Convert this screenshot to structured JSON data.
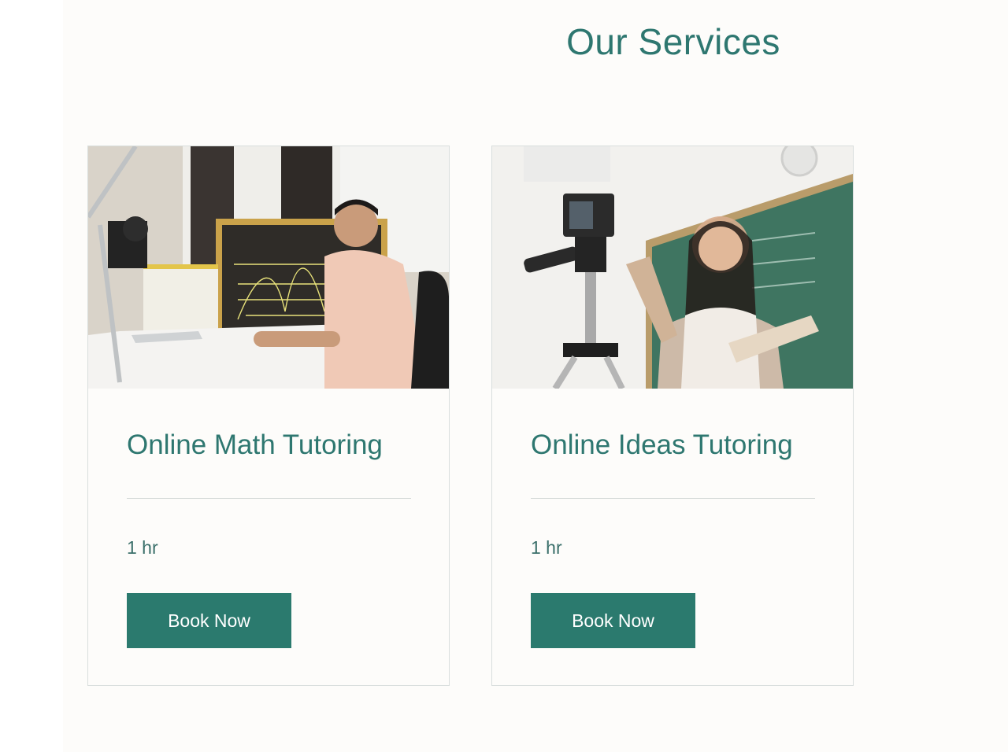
{
  "section": {
    "title": "Our Services"
  },
  "services": [
    {
      "image_icon": "math-tutor-photo",
      "title": "Online Math Tutoring",
      "duration": "1 hr",
      "button_label": "Book Now"
    },
    {
      "image_icon": "ideas-tutor-photo",
      "title": "Online Ideas Tutoring",
      "duration": "1 hr",
      "button_label": "Book Now"
    }
  ],
  "colors": {
    "accent": "#2e7770",
    "button": "#2b7a6e",
    "background": "#fdfcfa"
  }
}
